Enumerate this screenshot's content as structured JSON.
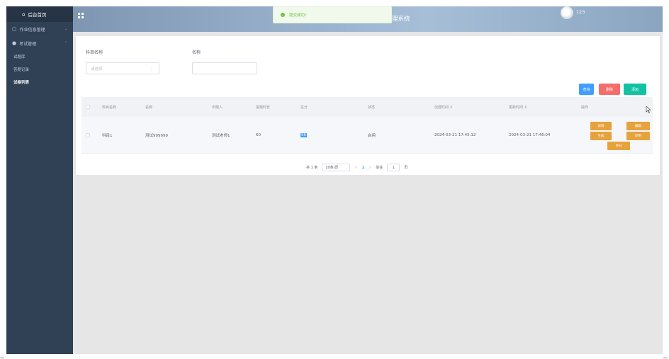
{
  "sidebar": {
    "logo": "后台首页",
    "menu": [
      {
        "label": "作业信息管理"
      },
      {
        "label": "考试管理"
      }
    ],
    "submenu": [
      {
        "label": "试题库"
      },
      {
        "label": "答题记录"
      },
      {
        "label": "试卷列表"
      }
    ]
  },
  "header": {
    "title": "理系统",
    "user": "123"
  },
  "toast": {
    "message": "提交成功!"
  },
  "search": {
    "subject_label": "科目名称",
    "subject_placeholder": "请选择",
    "name_label": "名称",
    "name_value": ""
  },
  "buttons": {
    "query": "查询",
    "delete": "删除",
    "add": "添加"
  },
  "table": {
    "headers": [
      "科目名称",
      "名称",
      "出题人",
      "答题时长",
      "总分",
      "状态",
      "创建时间 ⇕",
      "更新时间 ⇕",
      "操作"
    ],
    "rows": [
      {
        "subject": "科目1",
        "name": "测试999999",
        "author": "测试老师1",
        "duration": "60",
        "score": "50",
        "status": "启用",
        "created": "2024-03-21 17:45:12",
        "updated": "2024-03-21 17:46:04",
        "ops": [
          "详情",
          "编辑",
          "生成",
          "停用",
          "评分"
        ]
      }
    ]
  },
  "pagination": {
    "total": "共 1 条",
    "page_size": "10条/页",
    "prev": "<",
    "current": "1",
    "next": ">",
    "goto": "前往",
    "goto_value": "1",
    "page_unit": "页"
  }
}
